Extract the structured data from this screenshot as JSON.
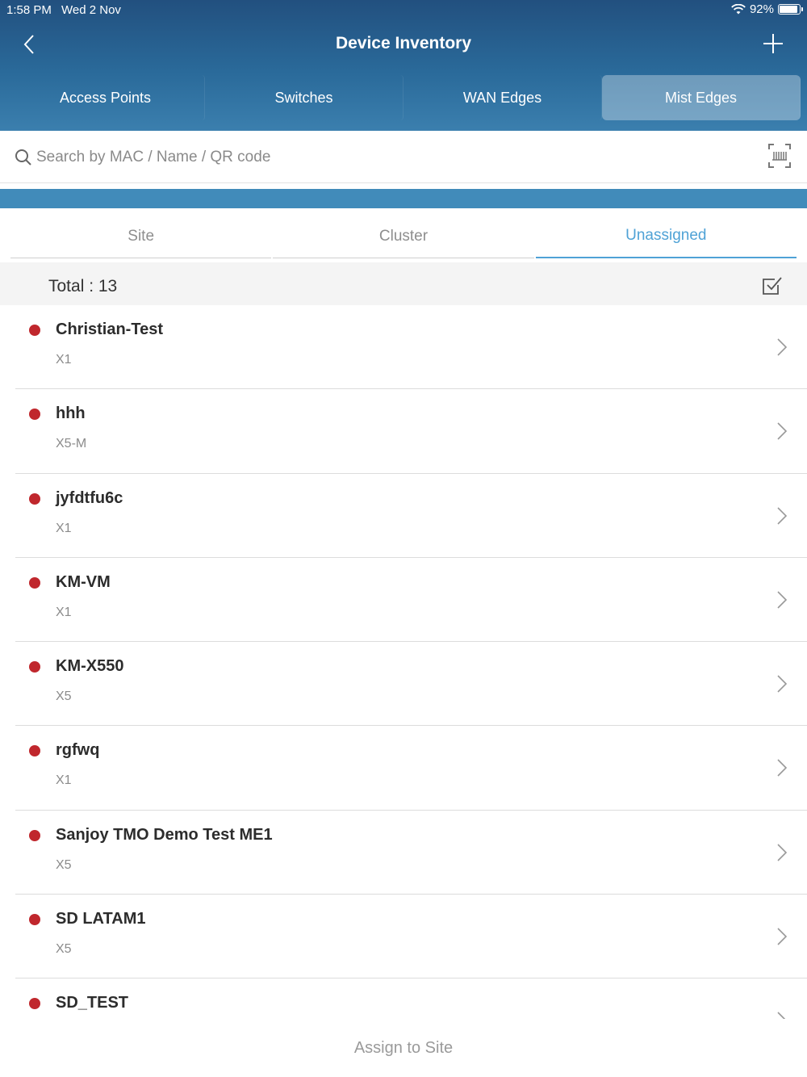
{
  "status": {
    "time": "1:58 PM",
    "date": "Wed 2 Nov",
    "battery": "92%",
    "battery_level": 0.92
  },
  "nav": {
    "title": "Device Inventory"
  },
  "device_types": [
    {
      "label": "Access Points"
    },
    {
      "label": "Switches"
    },
    {
      "label": "WAN Edges"
    },
    {
      "label": "Mist Edges"
    }
  ],
  "device_type_selected": "Mist Edges",
  "search": {
    "placeholder": "Search by MAC / Name / QR code",
    "value": ""
  },
  "tabs": [
    {
      "label": "Site"
    },
    {
      "label": "Cluster"
    },
    {
      "label": "Unassigned"
    }
  ],
  "tab_selected": "Unassigned",
  "total": {
    "label": "Total : 13"
  },
  "devices": [
    {
      "name": "Christian-Test",
      "model": "X1"
    },
    {
      "name": "hhh",
      "model": "X5-M"
    },
    {
      "name": "jyfdtfu6c",
      "model": "X1"
    },
    {
      "name": "KM-VM",
      "model": "X1"
    },
    {
      "name": "KM-X550",
      "model": "X5"
    },
    {
      "name": "rgfwq",
      "model": "X1"
    },
    {
      "name": "Sanjoy TMO Demo Test ME1",
      "model": "X5"
    },
    {
      "name": "SD LATAM1",
      "model": "X5"
    },
    {
      "name": "SD_TEST",
      "model": ""
    }
  ],
  "footer": {
    "assign_label": "Assign to Site"
  },
  "colors": {
    "header": "#2a6a9a",
    "accent": "#4fa2d6",
    "status_dot": "#c0272d",
    "blue_bar": "#418bba"
  },
  "icons": [
    "back-icon",
    "add-icon",
    "search-icon",
    "barcode-scan-icon",
    "select-checkbox-icon",
    "chevron-right-icon",
    "wifi-icon",
    "battery-icon"
  ]
}
